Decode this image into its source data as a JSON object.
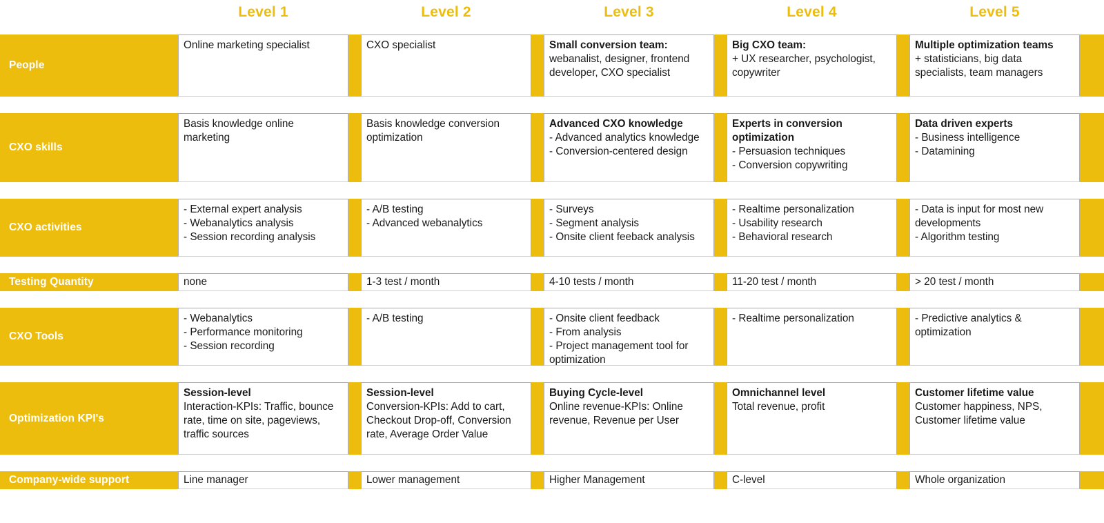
{
  "theme": {
    "accent_yellow": "#EDBD0D",
    "label_text": "#FFFFFF",
    "cell_text": "#1A1A1A",
    "cell_border": "#B0B0B0",
    "background": "#FFFFFF"
  },
  "header": {
    "levels": [
      {
        "label": "Level 1"
      },
      {
        "label": "Level 2"
      },
      {
        "label": "Level 3"
      },
      {
        "label": "Level 4"
      },
      {
        "label": "Level 5"
      }
    ]
  },
  "chart_data": {
    "type": "table",
    "title": "",
    "columns": [
      "",
      "Level 1",
      "Level 2",
      "Level 3",
      "Level 4",
      "Level 5"
    ],
    "rows": [
      {
        "label": "People",
        "cells": [
          {
            "heading": "",
            "body": "Online marketing specialist"
          },
          {
            "heading": "",
            "body": "CXO specialist"
          },
          {
            "heading": "Small conversion team:",
            "body": "webanalist, designer, frontend developer, CXO specialist"
          },
          {
            "heading": "Big CXO team:",
            "body": "+ UX researcher, psychologist, copywriter"
          },
          {
            "heading": "Multiple optimization teams",
            "body": "+ statisticians, big data specialists, team managers"
          }
        ]
      },
      {
        "label": "CXO skills",
        "cells": [
          {
            "heading": "",
            "body": "Basis knowledge online marketing"
          },
          {
            "heading": "",
            "body": "Basis knowledge conversion optimization"
          },
          {
            "heading": "Advanced CXO knowledge",
            "body": "- Advanced analytics knowledge\n- Conversion-centered design"
          },
          {
            "heading": "Experts in conversion optimization",
            "body": "- Persuasion techniques\n- Conversion copywriting"
          },
          {
            "heading": "Data driven experts",
            "body": "- Business intelligence\n- Datamining"
          }
        ]
      },
      {
        "label": "CXO activities",
        "cells": [
          {
            "heading": "",
            "body": "- External expert analysis\n- Webanalytics analysis\n- Session recording analysis"
          },
          {
            "heading": "",
            "body": "- A/B testing\n- Advanced webanalytics"
          },
          {
            "heading": "",
            "body": "- Surveys\n- Segment analysis\n- Onsite client feeback analysis"
          },
          {
            "heading": "",
            "body": "- Realtime personalization\n- Usability research\n- Behavioral research"
          },
          {
            "heading": "",
            "body": "- Data is input for most new developments\n- Algorithm testing"
          }
        ]
      },
      {
        "label": "Testing Quantity",
        "cells": [
          {
            "heading": "",
            "body": "none"
          },
          {
            "heading": "",
            "body": "1-3 test / month"
          },
          {
            "heading": "",
            "body": "4-10 tests / month"
          },
          {
            "heading": "",
            "body": "11-20 test / month"
          },
          {
            "heading": "",
            "body": "> 20 test / month"
          }
        ]
      },
      {
        "label": "CXO Tools",
        "cells": [
          {
            "heading": "",
            "body": "- Webanalytics\n- Performance monitoring\n- Session recording"
          },
          {
            "heading": "",
            "body": "- A/B testing"
          },
          {
            "heading": "",
            "body": "- Onsite client feedback\n- From analysis\n- Project management tool for optimization"
          },
          {
            "heading": "",
            "body": "- Realtime personalization"
          },
          {
            "heading": "",
            "body": "- Predictive analytics & optimization"
          }
        ]
      },
      {
        "label": "Optimization KPI's",
        "cells": [
          {
            "heading": "Session-level",
            "body": "Interaction-KPIs: Traffic, bounce rate, time on site, pageviews, traffic sources"
          },
          {
            "heading": "Session-level",
            "body": "Conversion-KPIs: Add to cart, Checkout Drop-off, Conversion rate, Average Order Value"
          },
          {
            "heading": "Buying Cycle-level",
            "body": "Online revenue-KPIs: Online revenue, Revenue per User"
          },
          {
            "heading": "Omnichannel level",
            "body": "Total revenue, profit"
          },
          {
            "heading": "Customer lifetime value",
            "body": "Customer happiness, NPS, Customer lifetime value"
          }
        ]
      },
      {
        "label": "Company-wide support",
        "cells": [
          {
            "heading": "",
            "body": "Line manager"
          },
          {
            "heading": "",
            "body": "Lower management"
          },
          {
            "heading": "",
            "body": "Higher Management"
          },
          {
            "heading": "",
            "body": "C-level"
          },
          {
            "heading": "",
            "body": "Whole organization"
          }
        ]
      }
    ]
  }
}
